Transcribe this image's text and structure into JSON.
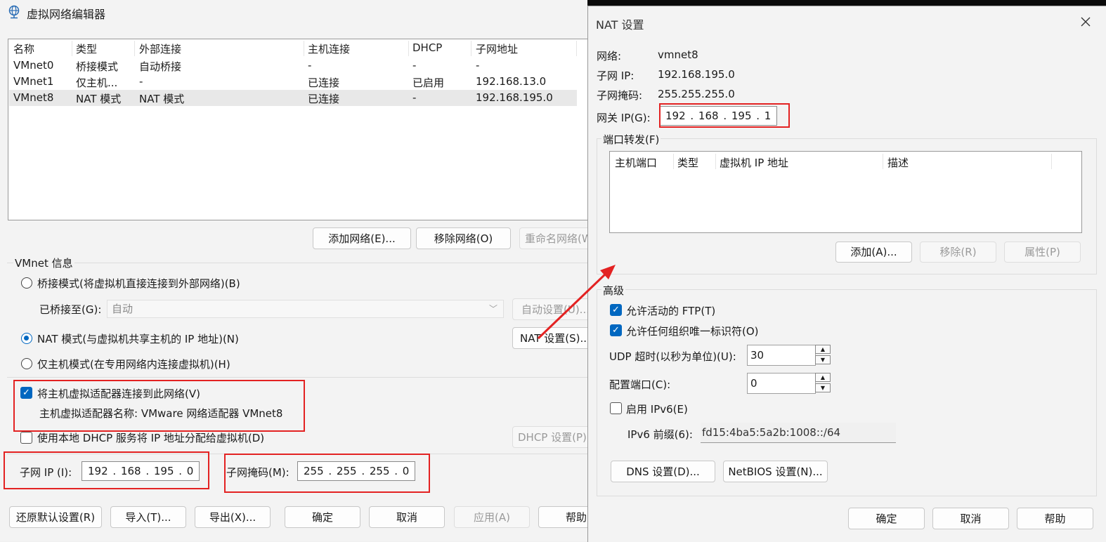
{
  "main": {
    "title": "虚拟网络编辑器",
    "columns": [
      "名称",
      "类型",
      "外部连接",
      "主机连接",
      "DHCP",
      "子网地址"
    ],
    "rows": [
      {
        "name": "VMnet0",
        "type": "桥接模式",
        "external": "自动桥接",
        "host": "-",
        "dhcp": "-",
        "subnet": "-"
      },
      {
        "name": "VMnet1",
        "type": "仅主机...",
        "external": "-",
        "host": "已连接",
        "dhcp": "已启用",
        "subnet": "192.168.13.0"
      },
      {
        "name": "VMnet8",
        "type": "NAT 模式",
        "external": "NAT 模式",
        "host": "已连接",
        "dhcp": "-",
        "subnet": "192.168.195.0"
      }
    ],
    "add_network": "添加网络(E)...",
    "remove_network": "移除网络(O)",
    "rename_network": "重命名网络(W)...",
    "vmnet_info": "VMnet 信息",
    "bridge_mode": "桥接模式(将虚拟机直接连接到外部网络)(B)",
    "bridged_to_label": "已桥接至(G):",
    "bridged_to_value": "自动",
    "auto_settings": "自动设置(U)...",
    "nat_mode": "NAT 模式(与虚拟机共享主机的 IP 地址)(N)",
    "nat_settings": "NAT 设置(S)...",
    "host_only": "仅主机模式(在专用网络内连接虚拟机)(H)",
    "connect_adapter": "将主机虚拟适配器连接到此网络(V)",
    "adapter_name": "主机虚拟适配器名称: VMware 网络适配器 VMnet8",
    "use_dhcp": "使用本地 DHCP 服务将 IP 地址分配给虚拟机(D)",
    "dhcp_settings": "DHCP 设置(P)...",
    "subnet_ip_label": "子网 IP (I):",
    "subnet_ip": "192 . 168 . 195 .  0",
    "subnet_mask_label": "子网掩码(M):",
    "subnet_mask": "255 . 255 . 255 .  0",
    "restore_defaults": "还原默认设置(R)",
    "import": "导入(T)...",
    "export": "导出(X)...",
    "ok": "确定",
    "cancel": "取消",
    "apply": "应用(A)",
    "help": "帮助"
  },
  "nat": {
    "title": "NAT 设置",
    "network_label": "网络:",
    "network_value": "vmnet8",
    "subnet_ip_label": "子网 IP:",
    "subnet_ip_value": "192.168.195.0",
    "subnet_mask_label": "子网掩码:",
    "subnet_mask_value": "255.255.255.0",
    "gateway_label": "网关 IP(G):",
    "gateway_value": "192 . 168 . 195 .  1",
    "port_forwarding": "端口转发(F)",
    "pf_columns": [
      "主机端口",
      "类型",
      "虚拟机 IP 地址",
      "描述"
    ],
    "add": "添加(A)...",
    "remove": "移除(R)",
    "properties": "属性(P)",
    "advanced": "高级",
    "allow_ftp": "允许活动的 FTP(T)",
    "allow_oui": "允许任何组织唯一标识符(O)",
    "udp_timeout_label": "UDP 超时(以秒为单位)(U):",
    "udp_timeout_value": "30",
    "config_port_label": "配置端口(C):",
    "config_port_value": "0",
    "enable_ipv6": "启用 IPv6(E)",
    "ipv6_prefix_label": "IPv6 前缀(6):",
    "ipv6_prefix_value": "fd15:4ba5:5a2b:1008::/64",
    "dns_settings": "DNS 设置(D)...",
    "netbios_settings": "NetBIOS 设置(N)...",
    "ok": "确定",
    "cancel": "取消",
    "help": "帮助"
  },
  "colors": {
    "accent": "#0067c0",
    "highlight": "#e32222"
  },
  "icons": {
    "app": "network-globe-icon",
    "close": "close-icon"
  }
}
